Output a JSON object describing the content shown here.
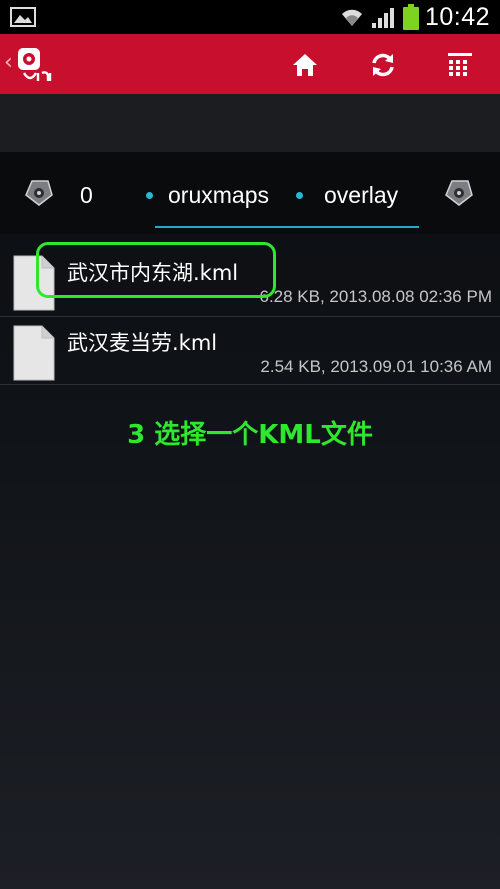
{
  "status_bar": {
    "time": "10:42",
    "icons": [
      "image-notification-icon",
      "wifi-icon",
      "signal-icon",
      "battery-icon"
    ],
    "battery_color": "#7ed321"
  },
  "action_bar": {
    "background": "#c8102e",
    "back_glyph": "‹",
    "logo_text": "oruxmaps-logo",
    "buttons": [
      "home-icon",
      "refresh-icon",
      "grid-menu-icon"
    ]
  },
  "breadcrumb": {
    "partial_segment": "0",
    "segments": [
      "oruxmaps",
      "overlay"
    ],
    "accent": "#2ab7d7"
  },
  "files": [
    {
      "name": "武汉市内东湖.kml",
      "meta": "6.28 KB, 2013.08.08 02:36 PM"
    },
    {
      "name": "武汉麦当劳.kml",
      "meta": "2.54 KB, 2013.09.01 10:36 AM"
    }
  ],
  "annotation": {
    "text": "3 选择一个KML文件",
    "color": "#2ee82e"
  }
}
